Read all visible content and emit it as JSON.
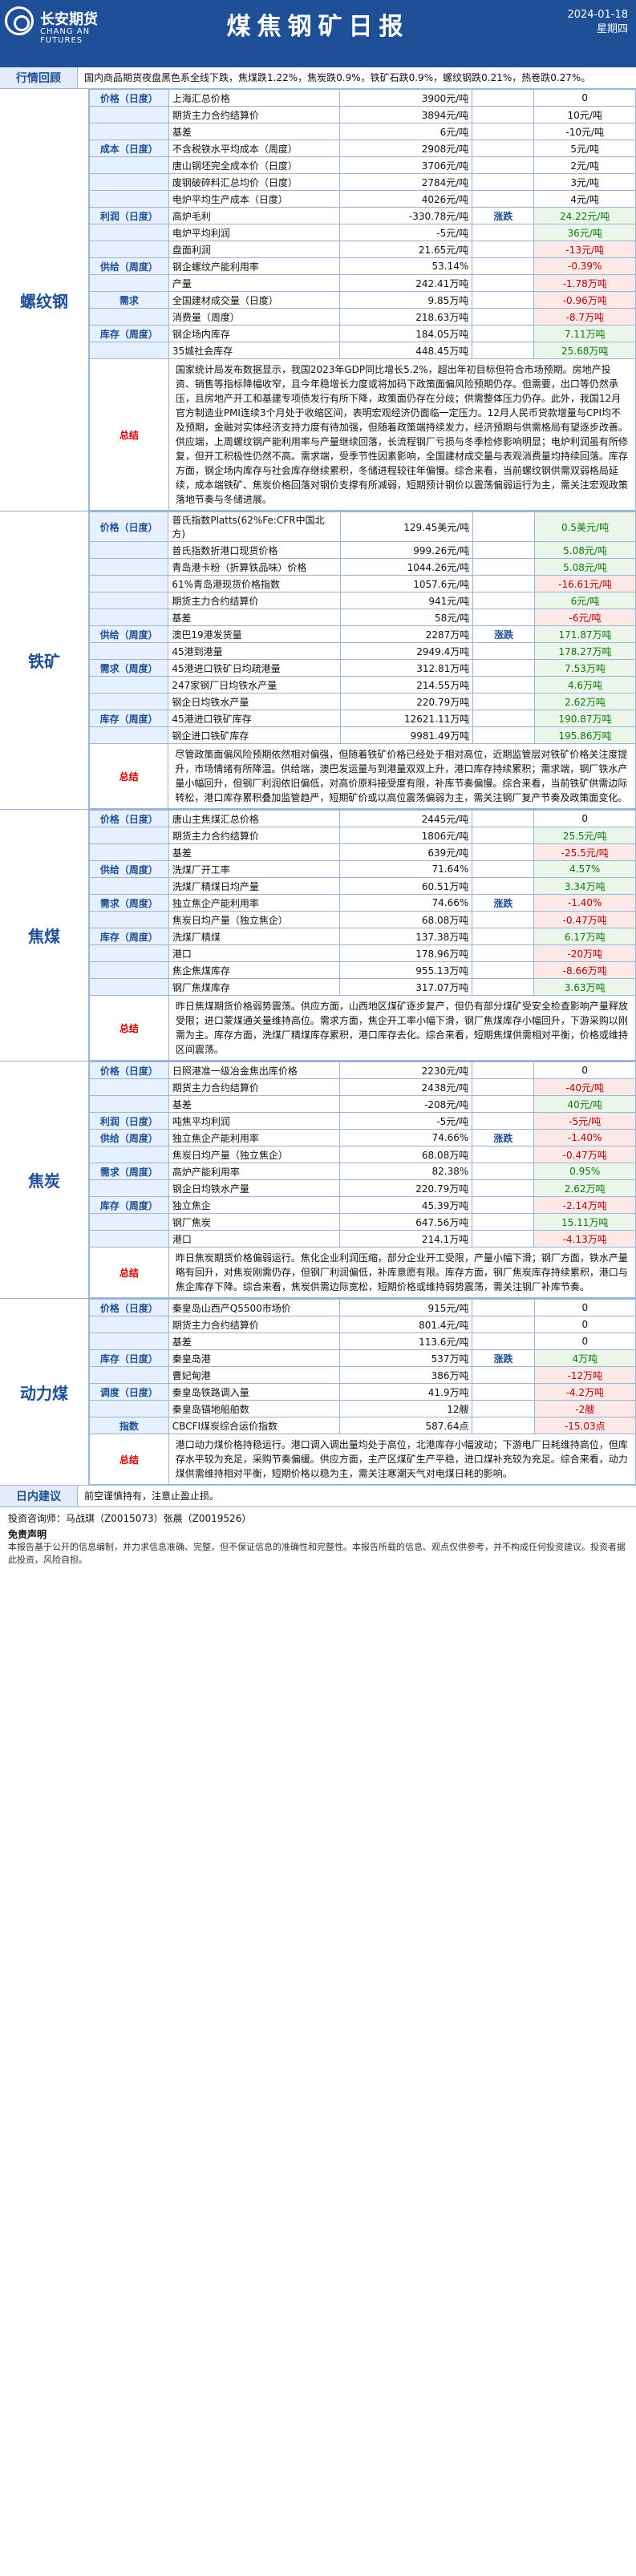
{
  "header": {
    "company_cn": "长安期货",
    "company_en": "CHANG AN FUTURES",
    "title": "煤焦钢矿日报",
    "date": "2024-01-18",
    "weekday": "星期四"
  },
  "market_review": {
    "label": "行情回顾",
    "text": "国内商品期货夜盘黑色系全线下跌，焦煤跌1.22%，焦炭跌0.9%，铁矿石跌0.9%，螺纹钢跌0.21%，热卷跌0.27%。"
  },
  "sections": [
    {
      "name": "螺纹钢",
      "rows": [
        {
          "cat": "价格（日度）",
          "item": "上海汇总价格",
          "value": "3900元/吨",
          "trend": "",
          "change": "0",
          "type": "neutral"
        },
        {
          "cat": "",
          "item": "期货主力合约结算价",
          "value": "3894元/吨",
          "trend": "",
          "change": "10元/吨",
          "type": "neutral"
        },
        {
          "cat": "",
          "item": "基差",
          "value": "6元/吨",
          "trend": "",
          "change": "-10元/吨",
          "type": "neutral"
        },
        {
          "cat": "成本（日度）",
          "item": "不含税铁水平均成本（周度）",
          "value": "2908元/吨",
          "trend": "",
          "change": "5元/吨",
          "type": "neutral"
        },
        {
          "cat": "",
          "item": "唐山钢坯完全成本价（日度）",
          "value": "3706元/吨",
          "trend": "",
          "change": "2元/吨",
          "type": "neutral"
        },
        {
          "cat": "",
          "item": "废钢破碎料汇总均价（日度）",
          "value": "2784元/吨",
          "trend": "",
          "change": "3元/吨",
          "type": "neutral"
        },
        {
          "cat": "",
          "item": "电炉平均生产成本（日度）",
          "value": "4026元/吨",
          "trend": "",
          "change": "4元/吨",
          "type": "neutral"
        },
        {
          "cat": "利润（日度）",
          "item": "高炉毛利",
          "value": "-330.78元/吨",
          "trend": "涨跌",
          "change": "24.22元/吨",
          "type": "pos"
        },
        {
          "cat": "",
          "item": "电炉平均利润",
          "value": "-5元/吨",
          "trend": "",
          "change": "36元/吨",
          "type": "pos"
        },
        {
          "cat": "",
          "item": "盘面利润",
          "value": "21.65元/吨",
          "trend": "",
          "change": "-13元/吨",
          "type": "neg"
        },
        {
          "cat": "供给（周度）",
          "item": "钢企螺纹产能利用率",
          "value": "53.14%",
          "trend": "",
          "change": "-0.39%",
          "type": "neg"
        },
        {
          "cat": "",
          "item": "产量",
          "value": "242.41万吨",
          "trend": "",
          "change": "-1.78万吨",
          "type": "neg"
        },
        {
          "cat": "需求",
          "item": "全国建材成交量（日度）",
          "value": "9.85万吨",
          "trend": "",
          "change": "-0.96万吨",
          "type": "neg"
        },
        {
          "cat": "",
          "item": "消费量（周度）",
          "value": "218.63万吨",
          "trend": "",
          "change": "-8.7万吨",
          "type": "neg"
        },
        {
          "cat": "库存（周度）",
          "item": "钢企场内库存",
          "value": "184.05万吨",
          "trend": "",
          "change": "7.11万吨",
          "type": "pos"
        },
        {
          "cat": "",
          "item": "35城社会库存",
          "value": "448.45万吨",
          "trend": "",
          "change": "25.68万吨",
          "type": "pos"
        }
      ],
      "summary_label": "总结",
      "summary": "国家统计局发布数据显示，我国2023年GDP同比增长5.2%，超出年初目标但符合市场预期。房地产投资、销售等指标降幅收窄，且今年稳增长力度或将加码下政策面偏风险预期仍存。但需要，出口等仍然承压，且房地产开工和基建专项债发行有所下降，政策面仍存在分歧；供需整体压力仍存。此外，我国12月官方制造业PMI连续3个月处于收缩区间，表明宏观经济仍面临一定压力。12月人民币贷款增量与CPI均不及预期，金融对实体经济支持力度有待加强，但随着政策端持续发力，经济预期与供需格局有望逐步改善。供应端，上周螺纹钢产能利用率与产量继续回落，长流程钢厂亏损与冬季检修影响明显；电炉利润虽有所修复，但开工积极性仍然不高。需求端，受季节性因素影响，全国建材成交量与表观消费量均持续回落。库存方面，钢企场内库存与社会库存继续累积，冬储进程较往年偏慢。综合来看，当前螺纹钢供需双弱格局延续，成本端铁矿、焦炭价格回落对钢价支撑有所减弱，短期预计钢价以震荡偏弱运行为主，需关注宏观政策落地节奏与冬储进展。"
    },
    {
      "name": "铁矿",
      "rows": [
        {
          "cat": "价格（日度）",
          "item": "普氏指数Platts(62%Fe:CFR中国北方)",
          "value": "129.45美元/吨",
          "trend": "",
          "change": "0.5美元/吨",
          "type": "pos"
        },
        {
          "cat": "",
          "item": "普氏指数折港口现货价格",
          "value": "999.26元/吨",
          "trend": "",
          "change": "5.08元/吨",
          "type": "pos"
        },
        {
          "cat": "",
          "item": "青岛港卡粉（折算铁品味）价格",
          "value": "1044.26元/吨",
          "trend": "",
          "change": "5.08元/吨",
          "type": "pos"
        },
        {
          "cat": "",
          "item": "61%青岛港现货价格指数",
          "value": "1057.6元/吨",
          "trend": "",
          "change": "-16.61元/吨",
          "type": "neg"
        },
        {
          "cat": "",
          "item": "期货主力合约结算价",
          "value": "941元/吨",
          "trend": "",
          "change": "6元/吨",
          "type": "pos"
        },
        {
          "cat": "",
          "item": "基差",
          "value": "58元/吨",
          "trend": "",
          "change": "-6元/吨",
          "type": "neg"
        },
        {
          "cat": "供给（周度）",
          "item": "澳巴19港发货量",
          "value": "2287万吨",
          "trend": "涨跌",
          "change": "171.87万吨",
          "type": "pos"
        },
        {
          "cat": "",
          "item": "45港到港量",
          "value": "2949.4万吨",
          "trend": "",
          "change": "178.27万吨",
          "type": "pos"
        },
        {
          "cat": "需求（周度）",
          "item": "45港进口铁矿日均疏港量",
          "value": "312.81万吨",
          "trend": "",
          "change": "7.53万吨",
          "type": "pos"
        },
        {
          "cat": "",
          "item": "247家钢厂日均铁水产量",
          "value": "214.55万吨",
          "trend": "",
          "change": "4.6万吨",
          "type": "pos"
        },
        {
          "cat": "",
          "item": "钢企日均铁水产量",
          "value": "220.79万吨",
          "trend": "",
          "change": "2.62万吨",
          "type": "pos"
        },
        {
          "cat": "库存（周度）",
          "item": "45港进口铁矿库存",
          "value": "12621.11万吨",
          "trend": "",
          "change": "190.87万吨",
          "type": "pos"
        },
        {
          "cat": "",
          "item": "钢企进口铁矿库存",
          "value": "9981.49万吨",
          "trend": "",
          "change": "195.86万吨",
          "type": "pos"
        }
      ],
      "summary_label": "总结",
      "summary": "尽管政策面偏风险预期依然相对偏强，但随着铁矿价格已经处于相对高位，近期监管层对铁矿价格关注度提升，市场情绪有所降温。供给端，澳巴发运量与到港量双双上升，港口库存持续累积；需求端，钢厂铁水产量小幅回升，但钢厂利润依旧偏低，对高价原料接受度有限，补库节奏偏慢。综合来看，当前铁矿供需边际转松，港口库存累积叠加监管趋严，短期矿价或以高位震荡偏弱为主，需关注钢厂复产节奏及政策面变化。"
    },
    {
      "name": "焦煤",
      "rows": [
        {
          "cat": "价格（日度）",
          "item": "唐山主焦煤汇总价格",
          "value": "2445元/吨",
          "trend": "",
          "change": "0",
          "type": "neutral"
        },
        {
          "cat": "",
          "item": "期货主力合约结算价",
          "value": "1806元/吨",
          "trend": "",
          "change": "25.5元/吨",
          "type": "pos"
        },
        {
          "cat": "",
          "item": "基差",
          "value": "639元/吨",
          "trend": "",
          "change": "-25.5元/吨",
          "type": "neg"
        },
        {
          "cat": "供给（周度）",
          "item": "洗煤厂开工率",
          "value": "71.64%",
          "trend": "",
          "change": "4.57%",
          "type": "pos"
        },
        {
          "cat": "",
          "item": "洗煤厂精煤日均产量",
          "value": "60.51万吨",
          "trend": "",
          "change": "3.34万吨",
          "type": "pos"
        },
        {
          "cat": "需求（周度）",
          "item": "独立焦企产能利用率",
          "value": "74.66%",
          "trend": "涨跌",
          "change": "-1.40%",
          "type": "neg"
        },
        {
          "cat": "",
          "item": "焦炭日均产量（独立焦企）",
          "value": "68.08万吨",
          "trend": "",
          "change": "-0.47万吨",
          "type": "neg"
        },
        {
          "cat": "库存（周度）",
          "item": "洗煤厂精煤",
          "value": "137.38万吨",
          "trend": "",
          "change": "6.17万吨",
          "type": "pos"
        },
        {
          "cat": "",
          "item": "港口",
          "value": "178.96万吨",
          "trend": "",
          "change": "-20万吨",
          "type": "neg"
        },
        {
          "cat": "",
          "item": "焦企焦煤库存",
          "value": "955.13万吨",
          "trend": "",
          "change": "-8.66万吨",
          "type": "neg"
        },
        {
          "cat": "",
          "item": "钢厂焦煤库存",
          "value": "317.07万吨",
          "trend": "",
          "change": "3.63万吨",
          "type": "pos"
        }
      ],
      "summary_label": "总结",
      "summary": "昨日焦煤期货价格弱势震荡。供应方面，山西地区煤矿逐步复产，但仍有部分煤矿受安全检查影响产量释放受限；进口蒙煤通关量维持高位。需求方面，焦企开工率小幅下滑，钢厂焦煤库存小幅回升，下游采购以刚需为主。库存方面，洗煤厂精煤库存累积，港口库存去化。综合来看，短期焦煤供需相对平衡，价格或维持区间震荡。"
    },
    {
      "name": "焦炭",
      "rows": [
        {
          "cat": "价格（日度）",
          "item": "日照港准一级冶金焦出库价格",
          "value": "2230元/吨",
          "trend": "",
          "change": "0",
          "type": "neutral"
        },
        {
          "cat": "",
          "item": "期货主力合约结算价",
          "value": "2438元/吨",
          "trend": "",
          "change": "-40元/吨",
          "type": "neg"
        },
        {
          "cat": "",
          "item": "基差",
          "value": "-208元/吨",
          "trend": "",
          "change": "40元/吨",
          "type": "pos"
        },
        {
          "cat": "利润（日度）",
          "item": "吨焦平均利润",
          "value": "-5元/吨",
          "trend": "",
          "change": "-5元/吨",
          "type": "neg"
        },
        {
          "cat": "供给（周度）",
          "item": "独立焦企产能利用率",
          "value": "74.66%",
          "trend": "涨跌",
          "change": "-1.40%",
          "type": "neg"
        },
        {
          "cat": "",
          "item": "焦炭日均产量（独立焦企）",
          "value": "68.08万吨",
          "trend": "",
          "change": "-0.47万吨",
          "type": "neg"
        },
        {
          "cat": "需求（周度）",
          "item": "高炉产能利用率",
          "value": "82.38%",
          "trend": "",
          "change": "0.95%",
          "type": "pos"
        },
        {
          "cat": "",
          "item": "钢企日均铁水产量",
          "value": "220.79万吨",
          "trend": "",
          "change": "2.62万吨",
          "type": "pos"
        },
        {
          "cat": "库存（周度）",
          "item": "独立焦企",
          "value": "45.39万吨",
          "trend": "",
          "change": "-2.14万吨",
          "type": "neg"
        },
        {
          "cat": "",
          "item": "钢厂焦炭",
          "value": "647.56万吨",
          "trend": "",
          "change": "15.11万吨",
          "type": "pos"
        },
        {
          "cat": "",
          "item": "港口",
          "value": "214.1万吨",
          "trend": "",
          "change": "-4.13万吨",
          "type": "neg"
        }
      ],
      "summary_label": "总结",
      "summary": "昨日焦炭期货价格偏弱运行。焦化企业利润压缩，部分企业开工受限，产量小幅下滑；钢厂方面，铁水产量略有回升，对焦炭刚需仍存，但钢厂利润偏低，补库意愿有限。库存方面，钢厂焦炭库存持续累积，港口与焦企库存下降。综合来看，焦炭供需边际宽松，短期价格或维持弱势震荡，需关注钢厂补库节奏。"
    },
    {
      "name": "动力煤",
      "rows": [
        {
          "cat": "价格（日度）",
          "item": "秦皇岛山西产Q5500市场价",
          "value": "915元/吨",
          "trend": "",
          "change": "0",
          "type": "neutral"
        },
        {
          "cat": "",
          "item": "期货主力合约结算价",
          "value": "801.4元/吨",
          "trend": "",
          "change": "0",
          "type": "neutral"
        },
        {
          "cat": "",
          "item": "基差",
          "value": "113.6元/吨",
          "trend": "",
          "change": "0",
          "type": "neutral"
        },
        {
          "cat": "库存（日度）",
          "item": "秦皇岛港",
          "value": "537万吨",
          "trend": "涨跌",
          "change": "4万吨",
          "type": "pos"
        },
        {
          "cat": "",
          "item": "曹妃甸港",
          "value": "386万吨",
          "trend": "",
          "change": "-12万吨",
          "type": "neg"
        },
        {
          "cat": "调度（日度）",
          "item": "秦皇岛铁路调入量",
          "value": "41.9万吨",
          "trend": "",
          "change": "-4.2万吨",
          "type": "neg"
        },
        {
          "cat": "",
          "item": "秦皇岛锚地船舶数",
          "value": "12艘",
          "trend": "",
          "change": "-2艘",
          "type": "neg"
        },
        {
          "cat": "指数",
          "item": "CBCFI煤炭综合运价指数",
          "value": "587.64点",
          "trend": "",
          "change": "-15.03点",
          "type": "neg"
        }
      ],
      "summary_label": "总结",
      "summary": "港口动力煤价格持稳运行。港口调入调出量均处于高位，北港库存小幅波动；下游电厂日耗维持高位，但库存水平较为充足，采购节奏偏缓。供应方面，主产区煤矿生产平稳，进口煤补充较为充足。综合来看，动力煤供需维持相对平衡，短期价格以稳为主，需关注寒潮天气对电煤日耗的影响。"
    }
  ],
  "daily_advice": {
    "label": "日内建议",
    "text": "前空谨慎持有，注意止盈止损。"
  },
  "analysts": {
    "text": "投资咨询师：马战琪（Z0015073）张晨（Z0019526）"
  },
  "disclaimer": {
    "title": "免责声明",
    "text": "本报告基于公开的信息编制，并力求信息准确、完整，但不保证信息的准确性和完整性。本报告所载的信息、观点仅供参考，并不构成任何投资建议。投资者据此投资，风险自担。"
  }
}
